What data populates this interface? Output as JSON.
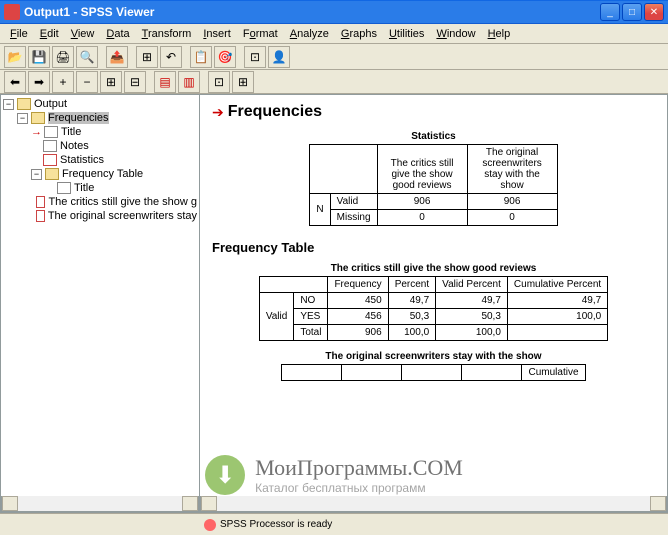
{
  "window": {
    "title": "Output1 - SPSS Viewer"
  },
  "menu": [
    "File",
    "Edit",
    "View",
    "Data",
    "Transform",
    "Insert",
    "Format",
    "Analyze",
    "Graphs",
    "Utilities",
    "Window",
    "Help"
  ],
  "tree": {
    "root": "Output",
    "frequencies": "Frequencies",
    "title1": "Title",
    "notes": "Notes",
    "statistics": "Statistics",
    "freq_table": "Frequency Table",
    "title2": "Title",
    "item1": "The critics still give the show g",
    "item2": "The original screenwriters stay"
  },
  "content": {
    "heading": "Frequencies",
    "stats": {
      "title": "Statistics",
      "col1": "The critics still give the show good reviews",
      "col2": "The original screenwriters stay with the show",
      "n": "N",
      "valid": "Valid",
      "missing": "Missing",
      "v1": "906",
      "v2": "906",
      "m1": "0",
      "m2": "0"
    },
    "freq_heading": "Frequency Table",
    "table1": {
      "title": "The critics still give the show good reviews",
      "h_freq": "Frequency",
      "h_pct": "Percent",
      "h_vpct": "Valid Percent",
      "h_cpct": "Cumulative Percent",
      "valid": "Valid",
      "r1": {
        "lbl": "NO",
        "f": "450",
        "p": "49,7",
        "vp": "49,7",
        "cp": "49,7"
      },
      "r2": {
        "lbl": "YES",
        "f": "456",
        "p": "50,3",
        "vp": "50,3",
        "cp": "100,0"
      },
      "r3": {
        "lbl": "Total",
        "f": "906",
        "p": "100,0",
        "vp": "100,0",
        "cp": ""
      }
    },
    "table2": {
      "title": "The original screenwriters stay with the show",
      "h_cpct": "Cumulative"
    }
  },
  "status": "SPSS Processor  is ready",
  "watermark": {
    "main": "МоиПрограммы.COM",
    "sub": "Каталог бесплатных программ"
  }
}
